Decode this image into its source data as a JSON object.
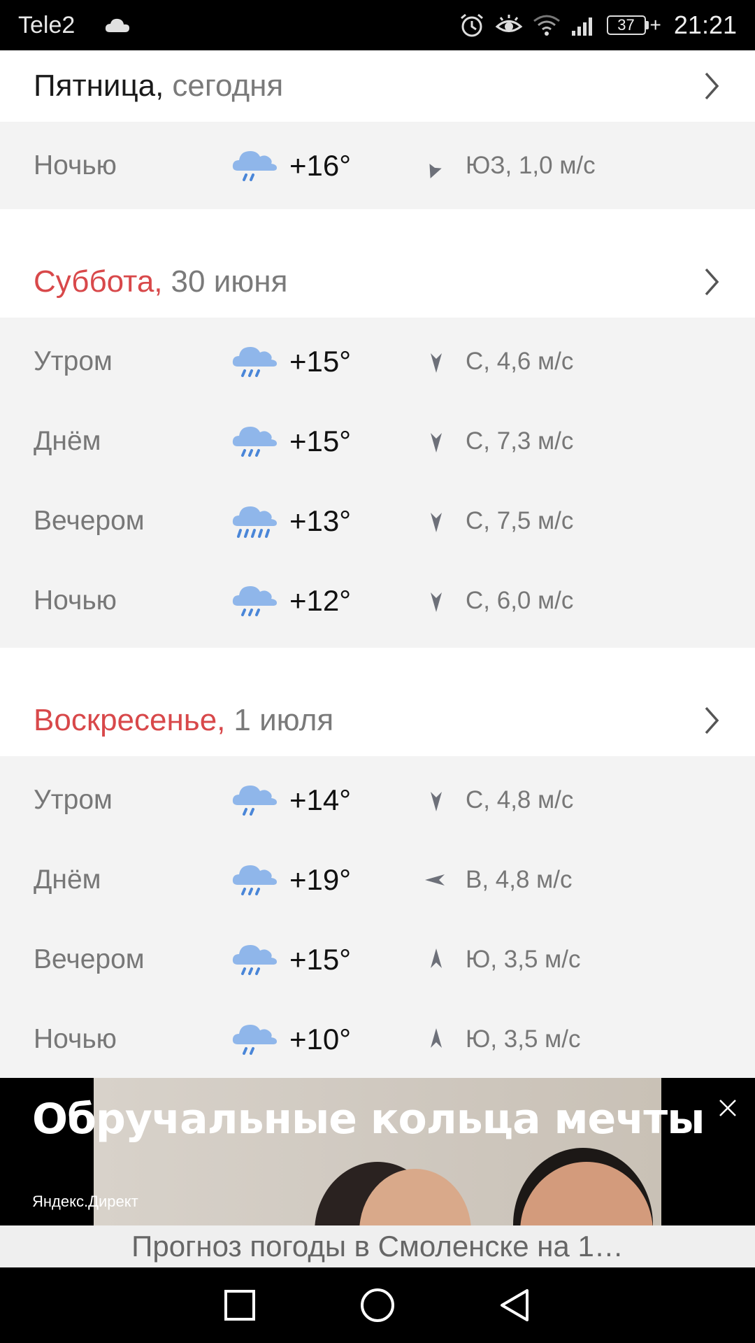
{
  "status_bar": {
    "carrier": "Tele2",
    "battery": "37",
    "time": "21:21"
  },
  "days": [
    {
      "name": "Пятница,",
      "date": "сегодня",
      "periods": [
        {
          "label": "Ночью",
          "temp": "+16°",
          "wind": "ЮЗ, 1,0 м/с",
          "wind_icon": "arrow-southwest-icon"
        }
      ]
    },
    {
      "name": "Суббота,",
      "date": "30 июня",
      "periods": [
        {
          "label": "Утром",
          "temp": "+15°",
          "wind": "С, 4,6 м/с",
          "wind_icon": "arrow-down-icon"
        },
        {
          "label": "Днём",
          "temp": "+15°",
          "wind": "С, 7,3 м/с",
          "wind_icon": "arrow-down-icon"
        },
        {
          "label": "Вечером",
          "temp": "+13°",
          "wind": "С, 7,5 м/с",
          "wind_icon": "arrow-down-icon"
        },
        {
          "label": "Ночью",
          "temp": "+12°",
          "wind": "С, 6,0 м/с",
          "wind_icon": "arrow-down-icon"
        }
      ]
    },
    {
      "name": "Воскресенье,",
      "date": "1 июля",
      "periods": [
        {
          "label": "Утром",
          "temp": "+14°",
          "wind": "С, 4,8 м/с",
          "wind_icon": "arrow-down-icon"
        },
        {
          "label": "Днём",
          "temp": "+19°",
          "wind": "В, 4,8 м/с",
          "wind_icon": "arrow-left-icon"
        },
        {
          "label": "Вечером",
          "temp": "+15°",
          "wind": "Ю, 3,5 м/с",
          "wind_icon": "arrow-up-icon"
        },
        {
          "label": "Ночью",
          "temp": "+10°",
          "wind": "Ю, 3,5 м/с",
          "wind_icon": "arrow-up-icon"
        }
      ]
    }
  ],
  "ad": {
    "title": "Обручальные кольца мечты",
    "source": "Яндекс.Директ"
  },
  "bottom_title": "Прогноз погоды в Смоленске на 1…",
  "colors": {
    "weekend": "#d8484a",
    "rain_cloud": "#8fb6ea",
    "rain_drops": "#4a86d8",
    "wind_arrow": "#6d7079"
  }
}
